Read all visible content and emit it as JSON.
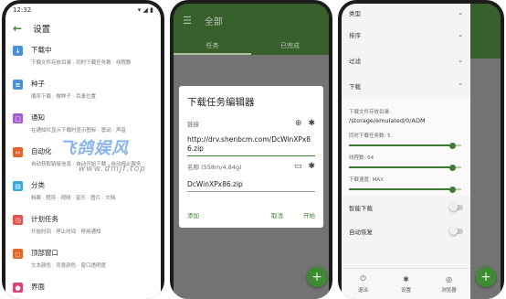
{
  "phone1": {
    "status_time": "12:32",
    "status_right": "▾ ◢ ▮",
    "title": "设置",
    "items": [
      {
        "icon": "download-icon",
        "color": "#4a8fd8",
        "glyph": "↓",
        "title": "下载中",
        "subtitle": "下载文件存放目录 · 同时下载任务数 · 线程数"
      },
      {
        "icon": "seed-icon",
        "color": "#4a8fd8",
        "glyph": "≡",
        "title": "种子",
        "subtitle": "顺序下载 · 做种子 · 目录位置"
      },
      {
        "icon": "notification-icon",
        "color": "#a35cc9",
        "glyph": "□",
        "title": "通知",
        "subtitle": "在通知栏显示下载时显示图标 · 震动 · 声音"
      },
      {
        "icon": "automation-icon",
        "color": "#e3652e",
        "glyph": "‹›",
        "title": "自动化",
        "subtitle": "自动获取链接信息 · 自动开始下载 · 自动停止服务"
      },
      {
        "icon": "category-icon",
        "color": "#3aa7d9",
        "glyph": "▤",
        "title": "分类",
        "subtitle": "档案 · 程序 · 视频 · 音乐 · 图片 · 文档"
      },
      {
        "icon": "schedule-icon",
        "color": "#e0534f",
        "glyph": "◷",
        "title": "计划任务",
        "subtitle": "开始时间 · 停止时间 · 停用通知"
      },
      {
        "icon": "floating-window-icon",
        "color": "#e3652e",
        "glyph": "◻",
        "title": "顶部窗口",
        "subtitle": "文本颜色 · 背景颜色 · 窗口透明度"
      },
      {
        "icon": "theme-icon",
        "color": "#d9457a",
        "glyph": "●",
        "title": "界面",
        "subtitle": ""
      }
    ]
  },
  "phone2": {
    "title": "全部",
    "tabs": [
      "任务",
      "已完成"
    ],
    "dialog": {
      "title": "下载任务编辑器",
      "link_label": "链接",
      "url": "http://drv.shenbcm.com/DcWinXPx86.zip",
      "name_label": "名称 (558m/4.84g)",
      "filename": "DcWinXPx86.zip",
      "add": "添加",
      "cancel": "取消",
      "start": "开始"
    },
    "watermark": "飞鸽娱风",
    "watermark_url": "www.dmjf.top"
  },
  "phone3": {
    "rows_top": [
      "类型",
      "排序",
      "过滤"
    ],
    "download_section": "下载",
    "dir_label": "下载文件存放目录:",
    "dir_value": "/storage/emulated/0/ADM",
    "sliders": [
      {
        "label": "同时下载任务数: 5",
        "value": 0.92
      },
      {
        "label": "线程数: 64",
        "value": 0.92
      },
      {
        "label": "下载速度: MAX",
        "value": 0.92
      }
    ],
    "toggles": [
      {
        "label": "智能下载",
        "on": false
      },
      {
        "label": "自动恢复",
        "on": false
      }
    ],
    "nav": [
      {
        "icon": "power-icon",
        "glyph": "⏻",
        "label": "退出"
      },
      {
        "icon": "settings-icon",
        "glyph": "✱",
        "label": "设置"
      },
      {
        "icon": "browser-icon",
        "glyph": "◎",
        "label": "浏览器"
      }
    ]
  },
  "colors": {
    "primary": "#38602c",
    "accent": "#3f7b32",
    "fab": "#3f8b34"
  }
}
